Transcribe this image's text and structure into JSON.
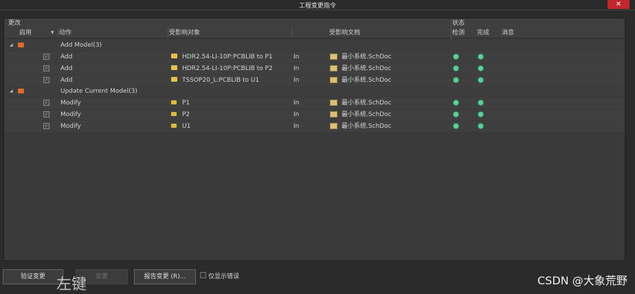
{
  "window": {
    "title": "工程变更指令",
    "close_symbol": "✕"
  },
  "groups": {
    "change": "更改",
    "status": "状态"
  },
  "columns": {
    "enable": "启用",
    "action": "动作",
    "affected_object": "受影响对象",
    "affected_document": "受影响文档",
    "check": "检测",
    "done": "完成",
    "message": "消息"
  },
  "rows": [
    {
      "type": "group",
      "label": "Add Model(3)"
    },
    {
      "type": "item",
      "action": "Add",
      "object": "HDR2.54-LI-10P:PCBLIB to P1",
      "dir": "In",
      "document": "最小系统.SchDoc",
      "check": "ok",
      "done": "ok"
    },
    {
      "type": "item",
      "action": "Add",
      "object": "HDR2.54-LI-10P:PCBLIB to P2",
      "dir": "In",
      "document": "最小系统.SchDoc",
      "check": "ok",
      "done": "ok"
    },
    {
      "type": "item",
      "action": "Add",
      "object": "TSSOP20_L:PCBLIB to U1",
      "dir": "In",
      "document": "最小系统.SchDoc",
      "check": "ok",
      "done": "ok"
    },
    {
      "type": "group",
      "label": "Update Current Model(3)"
    },
    {
      "type": "item",
      "action": "Modify",
      "object": "P1",
      "dir": "In",
      "document": "最小系统.SchDoc",
      "check": "ok",
      "done": "ok"
    },
    {
      "type": "item",
      "action": "Modify",
      "object": "P2",
      "dir": "In",
      "document": "最小系统.SchDoc",
      "check": "ok",
      "done": "ok"
    },
    {
      "type": "item",
      "action": "Modify",
      "object": "U1",
      "dir": "In",
      "document": "最小系统.SchDoc",
      "check": "ok",
      "done": "ok"
    }
  ],
  "buttons": {
    "validate": "验证变更",
    "execute": "变更",
    "report": "报告变更 (R)...",
    "only_errors": "仅显示错误"
  },
  "overlay_text": "左键",
  "watermark": "CSDN @大象荒野",
  "colors": {
    "ok": "#5fd09a",
    "close": "#c4262b",
    "folder": "#e6c24a"
  }
}
